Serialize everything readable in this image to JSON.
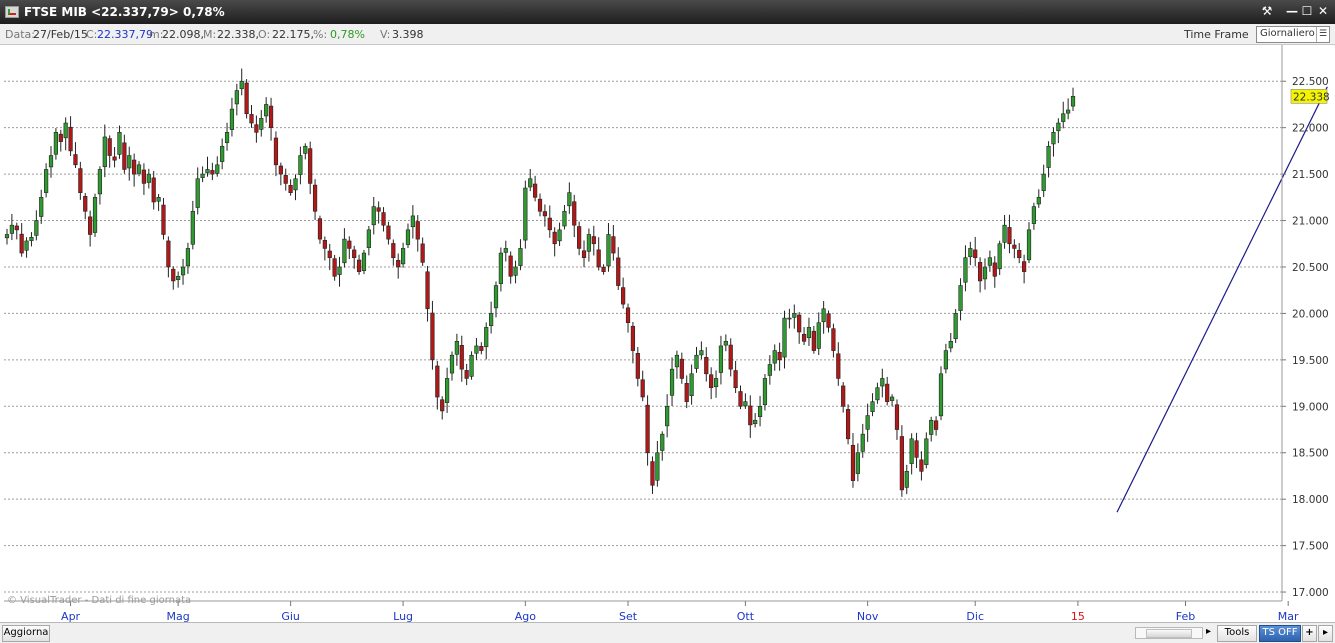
{
  "window": {
    "title": "FTSE MIB <22.337,79> 0,78%",
    "buttons": [
      "⚒",
      "—",
      "☐",
      "✕"
    ]
  },
  "infobar": {
    "date_label": "Data:",
    "date_value": "27/Feb/15",
    "close_label": "C:",
    "close_value": "22.337,79",
    "min_label": "m:",
    "min_value": "22.098,",
    "max_label": "M:",
    "max_value": "22.338,",
    "open_label": "O:",
    "open_value": "22.175,",
    "pct_label": "%:",
    "pct_value": "0,78%",
    "vol_label": "V:",
    "vol_value": "3.398",
    "timeframe_label": "Time Frame",
    "timeframe_value": "Giornaliero"
  },
  "bottombar": {
    "refresh_label": "Aggiorna",
    "tools_label": "Tools",
    "ts_label": "TS OFF",
    "plus_label": "+",
    "arrow_label": "▸"
  },
  "colors": {
    "up": "#2f9a2f",
    "down": "#b11818",
    "trendline": "#1a1a8c",
    "price_tag_bg": "#f4f400",
    "axis_months": "#1d36c6"
  },
  "chart_data": {
    "type": "candlestick",
    "title": "FTSE MIB",
    "watermark": "© VisualTrader - Dati di fine giornata",
    "last_price_tag": "22.338",
    "ylim": [
      16950,
      22650
    ],
    "y_ticks": [
      "22.500",
      "22.000",
      "21.500",
      "21.000",
      "20.500",
      "20.000",
      "19.500",
      "19.000",
      "18.500",
      "18.000",
      "17.500",
      "17.000"
    ],
    "y_tick_values": [
      22500,
      22000,
      21500,
      21000,
      20500,
      20000,
      19500,
      19000,
      18500,
      18000,
      17500,
      17000
    ],
    "x_labels": [
      {
        "label": "Apr",
        "index": 13,
        "highlight": false
      },
      {
        "label": "Mag",
        "index": 35,
        "highlight": false
      },
      {
        "label": "Giu",
        "index": 58,
        "highlight": false
      },
      {
        "label": "Lug",
        "index": 81,
        "highlight": false
      },
      {
        "label": "Ago",
        "index": 106,
        "highlight": false
      },
      {
        "label": "Set",
        "index": 127,
        "highlight": false
      },
      {
        "label": "Ott",
        "index": 151,
        "highlight": false
      },
      {
        "label": "Nov",
        "index": 176,
        "highlight": false
      },
      {
        "label": "Dic",
        "index": 198,
        "highlight": false
      },
      {
        "label": "15",
        "index": 219,
        "highlight": true
      },
      {
        "label": "Feb",
        "index": 241,
        "highlight": false
      },
      {
        "label": "Mar",
        "index": 262,
        "highlight": false
      }
    ],
    "grid": "horizontal-dotted",
    "trendline": {
      "from": {
        "index": 227,
        "value": 17860
      },
      "to": {
        "index": 270,
        "value": 22440
      }
    },
    "closes": [
      20850,
      20950,
      20900,
      20650,
      20780,
      20820,
      21000,
      21250,
      21550,
      21700,
      21950,
      21850,
      22050,
      21750,
      21600,
      21300,
      21100,
      20850,
      21250,
      21550,
      21900,
      21700,
      21650,
      21950,
      21550,
      21700,
      21500,
      21600,
      21400,
      21500,
      21200,
      21250,
      20850,
      20500,
      20350,
      20400,
      20500,
      20700,
      21100,
      21450,
      21500,
      21550,
      21500,
      21600,
      21800,
      21950,
      22200,
      22400,
      22500,
      22150,
      22050,
      21950,
      22100,
      22250,
      22000,
      21600,
      21500,
      21400,
      21300,
      21450,
      21700,
      21800,
      21400,
      21100,
      20800,
      20700,
      20600,
      20400,
      20500,
      20800,
      20700,
      20600,
      20450,
      20650,
      20900,
      21150,
      21100,
      20950,
      20800,
      20600,
      20500,
      20700,
      20900,
      21050,
      20800,
      20550,
      20050,
      19500,
      19100,
      18950,
      19300,
      19550,
      19700,
      19400,
      19300,
      19550,
      19650,
      19600,
      19850,
      20000,
      20300,
      20650,
      20700,
      20400,
      20500,
      20700,
      21350,
      21450,
      21250,
      21100,
      21050,
      20900,
      20750,
      20900,
      21100,
      21300,
      20950,
      20700,
      20600,
      20850,
      20750,
      20500,
      20450,
      20850,
      20650,
      20300,
      20100,
      19900,
      19600,
      19300,
      19100,
      18500,
      18150,
      18500,
      18700,
      19000,
      19400,
      19550,
      19300,
      19050,
      19350,
      19550,
      19600,
      19350,
      19200,
      19300,
      19650,
      19700,
      19400,
      19200,
      19000,
      19050,
      18800,
      18850,
      19000,
      19300,
      19450,
      19600,
      19500,
      19950,
      19950,
      20000,
      19800,
      19700,
      19850,
      19600,
      19900,
      20050,
      19850,
      19600,
      19300,
      19000,
      18650,
      18200,
      18500,
      18700,
      18900,
      19050,
      19200,
      19300,
      19050,
      19100,
      18750,
      18100,
      18300,
      18650,
      18450,
      18300,
      18650,
      18850,
      18750,
      19350,
      19600,
      19700,
      20000,
      20300,
      20600,
      20700,
      20600,
      20350,
      20500,
      20600,
      20400,
      20750,
      20950,
      20750,
      20700,
      20600,
      20450,
      20900,
      21150,
      21250,
      21500,
      21800,
      21950,
      22050,
      22150,
      22190,
      22337.79
    ]
  }
}
